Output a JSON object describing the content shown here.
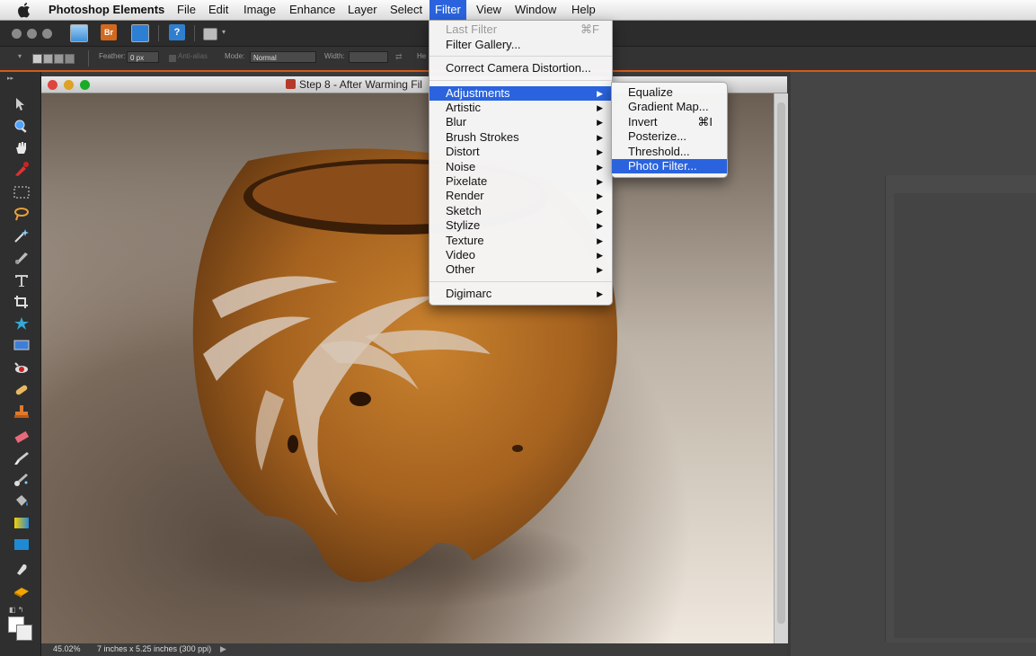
{
  "menubar": {
    "app_name": "Photoshop Elements",
    "items": [
      "File",
      "Edit",
      "Image",
      "Enhance",
      "Layer",
      "Select",
      "Filter",
      "View",
      "Window",
      "Help"
    ],
    "active": "Filter"
  },
  "options_bar": {
    "feather_label": "Feather:",
    "feather_value": "0 px",
    "antialias_label": "Anti-alias",
    "mode_label": "Mode:",
    "mode_value": "Normal",
    "width_label": "Width:",
    "height_label": "He"
  },
  "toolbar": {
    "bridge_label": "Br",
    "help_label": "?"
  },
  "document": {
    "title": "Step 8 - After Warming Fil",
    "zoom": "45.02%",
    "size_info": "7 inches x 5.25 inches (300 ppi)"
  },
  "filter_menu": {
    "last_filter": "Last Filter",
    "last_filter_shortcut": "⌘F",
    "filter_gallery": "Filter Gallery...",
    "correct_camera": "Correct Camera Distortion...",
    "submenus": [
      "Adjustments",
      "Artistic",
      "Blur",
      "Brush Strokes",
      "Distort",
      "Noise",
      "Pixelate",
      "Render",
      "Sketch",
      "Stylize",
      "Texture",
      "Video",
      "Other"
    ],
    "digimarc": "Digimarc"
  },
  "adjustments_menu": {
    "items": [
      "Equalize",
      "Gradient Map...",
      "Invert",
      "Posterize...",
      "Threshold...",
      "Photo Filter..."
    ],
    "invert_shortcut": "⌘I",
    "highlighted": "Photo Filter..."
  },
  "colors": {
    "menu_highlight": "#2a63dd",
    "accent_line": "#d65a16"
  },
  "tools": [
    "move-icon",
    "zoom-icon",
    "hand-icon",
    "eyedropper-icon",
    "marquee-icon",
    "lasso-icon",
    "magic-wand-icon",
    "quick-selection-icon",
    "type-icon",
    "crop-icon",
    "cookie-cutter-icon",
    "straighten-icon",
    "red-eye-icon",
    "healing-brush-icon",
    "clone-stamp-icon",
    "eraser-icon",
    "brush-icon",
    "smart-brush-icon",
    "paint-bucket-icon",
    "gradient-icon",
    "shape-icon",
    "blur-icon",
    "sponge-icon",
    "color-swatches-icon"
  ]
}
